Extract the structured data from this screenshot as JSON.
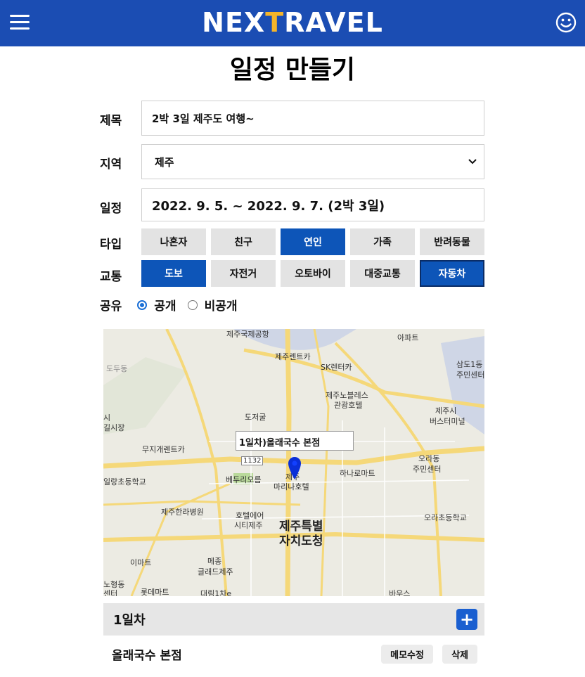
{
  "header": {
    "logo_part1": "NEX",
    "logo_accent": "T",
    "logo_part2": "RAVEL",
    "brand_color": "#1b4db3",
    "accent_color": "#f5b52a",
    "menu_icon": "hamburger-menu-icon",
    "profile_icon": "smiley-icon"
  },
  "page_title": "일정 만들기",
  "form": {
    "title_label": "제목",
    "title_value": "2박 3일 제주도 여행~",
    "region_label": "지역",
    "region_value": "제주",
    "schedule_label": "일정",
    "schedule_value": "2022. 9. 5. ~ 2022. 9. 7. (2박 3일)",
    "type_label": "타입",
    "type_options": [
      "나혼자",
      "친구",
      "연인",
      "가족",
      "반려동물"
    ],
    "type_selected": "연인",
    "transport_label": "교통",
    "transport_options": [
      "도보",
      "자전거",
      "오토바이",
      "대중교통",
      "자동차"
    ],
    "transport_selected": [
      "도보",
      "자동차"
    ],
    "share_label": "공유",
    "share_options": [
      "공개",
      "비공개"
    ],
    "share_selected": "공개"
  },
  "map": {
    "popup": "1일차)올래국수 본점",
    "labels": {
      "port": "제주국제공항",
      "apt": "아파트",
      "rent1": "제주렌트카",
      "rent2": "SK렌터카",
      "samdo": "삼도1동",
      "samdo2": "주민센터",
      "dodu": "도두동",
      "noble": "제주노블레스",
      "noble2": "관광호텔",
      "bus": "제주시",
      "bus2": "버스터미널",
      "market": "시",
      "market2": "길시장",
      "dojeo": "도저굴",
      "muji": "무지개렌트카",
      "ora": "오라동",
      "ora2": "주민센터",
      "road": "1132",
      "school1": "일랑초등학교",
      "betu": "베두리오름",
      "jeju": "제주",
      "marina": "마리나호텔",
      "hanaro": "하나로마트",
      "hospital": "제주한라병원",
      "hotel1": "호텔에어",
      "hotel2": "시티제주",
      "gov1": "제주특별",
      "gov2": "자치도청",
      "oraschool": "오라초등학교",
      "emart": "이마트",
      "mejong1": "메종",
      "mejong2": "글래드제주",
      "nohyeong": "노형동",
      "nohyeong2": "센터",
      "lotte": "롯데마트",
      "daerim": "대림1차e",
      "bawoo": "바우스"
    }
  },
  "itinerary": {
    "day_title": "1일차",
    "add_icon": "plus-icon",
    "place_name": "올래국수 본점",
    "edit_memo_label": "메모수정",
    "delete_label": "삭제"
  }
}
